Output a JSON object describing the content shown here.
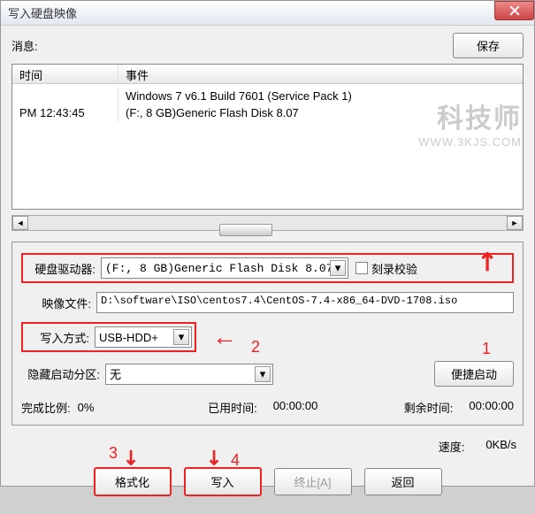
{
  "title": "写入硬盘映像",
  "msg_label": "消息:",
  "save_btn": "保存",
  "log": {
    "col_time": "时间",
    "col_event": "事件",
    "rows": [
      {
        "time": "",
        "event": "Windows 7 v6.1 Build 7601 (Service Pack 1)"
      },
      {
        "time": "PM 12:43:45",
        "event": "(F:, 8 GB)Generic Flash Disk      8.07"
      }
    ]
  },
  "fields": {
    "drive_label": "硬盘驱动器:",
    "drive_value": "(F:, 8 GB)Generic Flash Disk      8.07",
    "verify_label": "刻录校验",
    "image_label": "映像文件:",
    "image_value": "D:\\software\\ISO\\centos7.4\\CentOS-7.4-x86_64-DVD-1708.iso",
    "write_mode_label": "写入方式:",
    "write_mode_value": "USB-HDD+",
    "hide_boot_label": "隐藏启动分区:",
    "hide_boot_value": "无",
    "quick_boot_btn": "便捷启动"
  },
  "stats": {
    "done_pct_label": "完成比例:",
    "done_pct_value": "0%",
    "elapsed_label": "已用时间:",
    "elapsed_value": "00:00:00",
    "remain_label": "剩余时间:",
    "remain_value": "00:00:00",
    "speed_label": "速度:",
    "speed_value": "0KB/s"
  },
  "buttons": {
    "format": "格式化",
    "write": "写入",
    "abort": "终止[A]",
    "back": "返回"
  },
  "annotations": {
    "n1": "1",
    "n2": "2",
    "n3": "3",
    "n4": "4"
  },
  "watermark": {
    "big": "科技师",
    "small": "WWW.3KJS.COM"
  }
}
